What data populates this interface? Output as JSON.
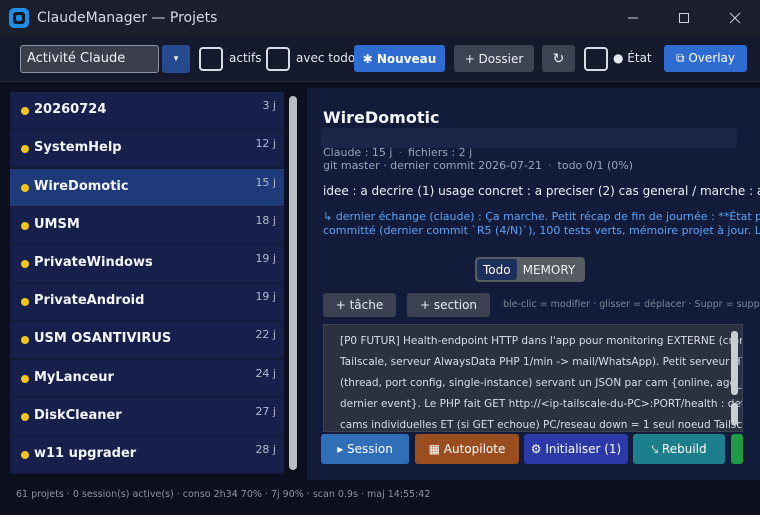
{
  "window": {
    "title": "ClaudeManager — Projets",
    "icon": "app-logo-icon",
    "controls": {
      "minimize": "─",
      "maximize": "☐",
      "close": "✕"
    }
  },
  "toolbar": {
    "filter_select": {
      "value": "Activité Claude",
      "arrow": "▾"
    },
    "checkbox_actifs": {
      "label": "actifs",
      "checked": false
    },
    "checkbox_avec_todo": {
      "label": "avec todo",
      "checked": false
    },
    "nouveau_label": "✱ Nouveau",
    "dossier_label": "+ Dossier",
    "refresh_glyph": "↻",
    "checkbox_etat": {
      "label": "● État",
      "checked": false
    },
    "overlay_label": "⧉ Overlay"
  },
  "projects": [
    {
      "name": "20260724",
      "age": "3 j"
    },
    {
      "name": "SystemHelp",
      "age": "12 j"
    },
    {
      "name": "WireDomotic",
      "age": "15 j"
    },
    {
      "name": "UMSM",
      "age": "18 j"
    },
    {
      "name": "PrivateWindows",
      "age": "19 j"
    },
    {
      "name": "PrivateAndroid",
      "age": "19 j"
    },
    {
      "name": "USM OSANTIVIRUS",
      "age": "22 j"
    },
    {
      "name": "MyLanceur",
      "age": "24 j"
    },
    {
      "name": "DiskCleaner",
      "age": "27 j"
    },
    {
      "name": "w11 upgrader",
      "age": "28 j"
    }
  ],
  "selected_project": "WireDomotic",
  "detail": {
    "title": "WireDomotic",
    "meta1": {
      "claude": "Claude : 15 j",
      "fichiers": "fichiers : 2 j"
    },
    "meta2": {
      "git": "git master · dernier commit 2026-07-21",
      "todo": "todo 0/1 (0%)"
    },
    "idea": "idee : a decrire (1) usage concret : a preciser (2) cas general / marche : a preciser",
    "exchange_line1": "↳ dernier échange (claude) : Ça marche. Petit récap de fin de journée : **État propre**",
    "exchange_line2": "committé (dernier commit `R5 (4/N)`), 100 tests verts, mémoire projet à jour. Le nouv",
    "tabs": [
      "Todo",
      "MEMORY"
    ],
    "active_tab": "Todo",
    "add_task_label": "+ tâche",
    "add_section_label": "+ section",
    "hint": "ble-clic = modifier · glisser = déplacer · Suppr = suppr",
    "todo_lines": [
      "[P0 FUTUR] Health-endpoint HTTP dans l'app pour monitoring EXTERNE (cron",
      "Tailscale, serveur AlwaysData PHP 1/min -> mail/WhatsApp). Petit serveur HT",
      "(thread, port config, single-instance) servant un JSON par cam {online, age_s",
      "dernier event}. Le PHP fait GET http://<ip-tailscale-du-PC>:PORT/health : dete",
      "cams individuelles ET (si GET echoue) PC/reseau down = 1 seul noeud Tailsca"
    ],
    "actions": {
      "session": "▸ Session",
      "autopilote": "▦ Autopilote",
      "initialiser": "⚙ Initialiser (1)",
      "rebuild": "⤥ Rebuild"
    }
  },
  "status_bar": "61 projets · 0 session(s) active(s) · conso 2h34 70% · 7j 90% · scan 0.9s · maj 14:55:42",
  "colors": {
    "accent": "#2e6cd2",
    "dot": "#f5c518",
    "session": "#2f6fb8",
    "autopilote": "#9a4d1f",
    "initialiser": "#2b3aa6",
    "rebuild": "#1d7f8c",
    "green": "#1e9b46"
  }
}
